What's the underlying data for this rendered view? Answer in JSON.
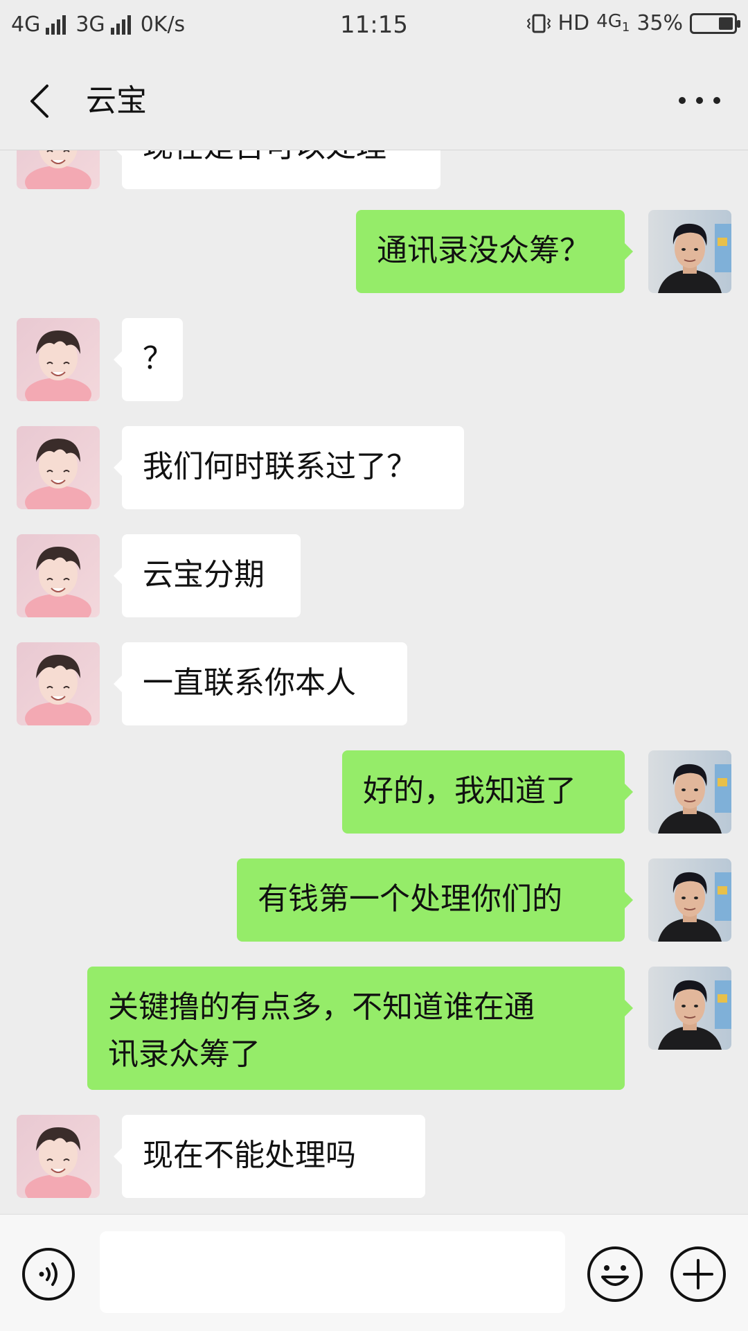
{
  "status_bar": {
    "network1": "4G",
    "network2": "3G",
    "speed": "0K/s",
    "time": "11:15",
    "hd": "HD",
    "network3": "4G",
    "sim_index": "1",
    "battery": "35%",
    "battery_level": 0.35
  },
  "header": {
    "title": "云宝",
    "back_icon": "chevron-left-icon",
    "more_icon": "more-dots-icon"
  },
  "messages": [
    {
      "from": "them",
      "text": "现在是否可以处理"
    },
    {
      "from": "me",
      "text": "通讯录没众筹？"
    },
    {
      "from": "them",
      "text": "？"
    },
    {
      "from": "them",
      "text": "我们何时联系过了？"
    },
    {
      "from": "them",
      "text": "云宝分期"
    },
    {
      "from": "them",
      "text": "一直联系你本人"
    },
    {
      "from": "me",
      "text": "好的，我知道了"
    },
    {
      "from": "me",
      "text": "有钱第一个处理你们的"
    },
    {
      "from": "me",
      "text": "关键撸的有点多，不知道谁在通\n讯录众筹了"
    },
    {
      "from": "them",
      "text": "现在不能处理吗"
    }
  ],
  "input_bar": {
    "voice_icon": "voice-icon",
    "text_value": "",
    "emoji_icon": "emoji-icon",
    "plus_icon": "plus-icon"
  },
  "colors": {
    "background": "#ededed",
    "my_bubble": "#95ec69",
    "their_bubble": "#ffffff"
  }
}
